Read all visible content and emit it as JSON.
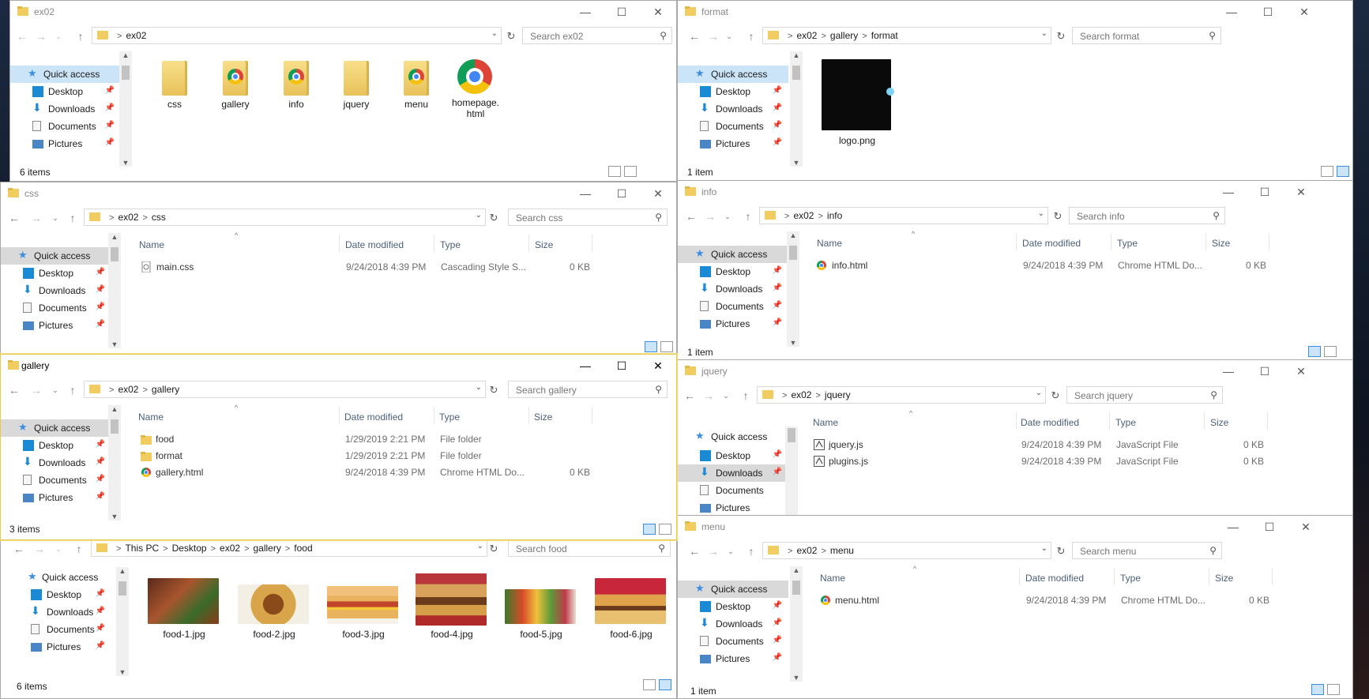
{
  "common": {
    "quick_access": "Quick access",
    "desktop": "Desktop",
    "downloads": "Downloads",
    "documents": "Documents",
    "pictures": "Pictures",
    "col_name": "Name",
    "col_date": "Date modified",
    "col_type": "Type",
    "col_size": "Size",
    "sep": ">"
  },
  "ex02": {
    "title": "ex02",
    "crumbs": [
      "ex02"
    ],
    "search_placeholder": "Search ex02",
    "status": "6 items",
    "tiles": [
      "css",
      "gallery",
      "info",
      "jquery",
      "menu",
      "homepage.\nhtml"
    ]
  },
  "format": {
    "title": "format",
    "crumbs": [
      "ex02",
      "gallery",
      "format"
    ],
    "search_placeholder": "Search format",
    "status": "1 item",
    "tile": "logo.png"
  },
  "css": {
    "title": "css",
    "crumbs": [
      "ex02",
      "css"
    ],
    "search_placeholder": "Search css",
    "rows": [
      {
        "name": "main.css",
        "date": "9/24/2018 4:39 PM",
        "type": "Cascading Style S...",
        "size": "0 KB"
      }
    ]
  },
  "info": {
    "title": "info",
    "crumbs": [
      "ex02",
      "info"
    ],
    "search_placeholder": "Search info",
    "status": "1 item",
    "rows": [
      {
        "name": "info.html",
        "date": "9/24/2018 4:39 PM",
        "type": "Chrome HTML Do...",
        "size": "0 KB"
      }
    ]
  },
  "gallery": {
    "title": "gallery",
    "crumbs": [
      "ex02",
      "gallery"
    ],
    "search_placeholder": "Search gallery",
    "status": "3 items",
    "rows": [
      {
        "name": "food",
        "date": "1/29/2019 2:21 PM",
        "type": "File folder",
        "size": ""
      },
      {
        "name": "format",
        "date": "1/29/2019 2:21 PM",
        "type": "File folder",
        "size": ""
      },
      {
        "name": "gallery.html",
        "date": "9/24/2018 4:39 PM",
        "type": "Chrome HTML Do...",
        "size": "0 KB"
      }
    ]
  },
  "jquery": {
    "title": "jquery",
    "crumbs": [
      "ex02",
      "jquery"
    ],
    "search_placeholder": "Search jquery",
    "rows": [
      {
        "name": "jquery.js",
        "date": "9/24/2018 4:39 PM",
        "type": "JavaScript File",
        "size": "0 KB"
      },
      {
        "name": "plugins.js",
        "date": "9/24/2018 4:39 PM",
        "type": "JavaScript File",
        "size": "0 KB"
      }
    ]
  },
  "food": {
    "crumbs": [
      "This PC",
      "Desktop",
      "ex02",
      "gallery",
      "food"
    ],
    "search_placeholder": "Search food",
    "status": "6 items",
    "tiles": [
      "food-1.jpg",
      "food-2.jpg",
      "food-3.jpg",
      "food-4.jpg",
      "food-5.jpg",
      "food-6.jpg"
    ]
  },
  "menu": {
    "title": "menu",
    "crumbs": [
      "ex02",
      "menu"
    ],
    "search_placeholder": "Search menu",
    "status": "1 item",
    "rows": [
      {
        "name": "menu.html",
        "date": "9/24/2018 4:39 PM",
        "type": "Chrome HTML Do...",
        "size": "0 KB"
      }
    ]
  },
  "colors": {
    "folder": "#f0cc61",
    "accent": "#0078d7",
    "selected": "#cce4f7",
    "active_border": "#e9c94a"
  },
  "icons": {
    "minimize": "minimize-icon",
    "maximize": "maximize-icon",
    "close": "close-icon",
    "pin": "pin-icon",
    "search": "search-icon"
  }
}
